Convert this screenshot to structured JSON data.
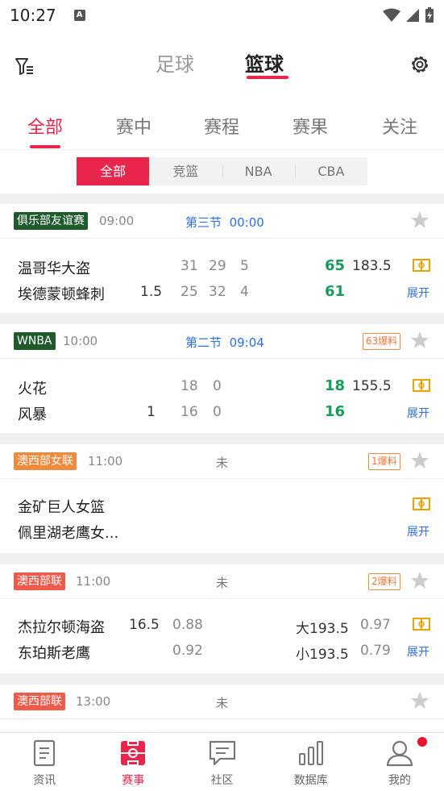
{
  "status": {
    "time": "10:27",
    "notif": "A"
  },
  "nav": {
    "football": "足球",
    "basketball": "篮球"
  },
  "categories": [
    "全部",
    "赛中",
    "赛程",
    "赛果",
    "关注"
  ],
  "segments": [
    "全部",
    "竞篮",
    "NBA",
    "CBA"
  ],
  "colors": {
    "accent": "#e8264c",
    "green": "#1a9a5c",
    "blue": "#2f6fe0",
    "league_dark": "#1e5a2a",
    "league_orange": "#f08a3c",
    "league_red": "#f05a4a"
  },
  "matches": [
    {
      "league": "俱乐部友谊赛",
      "time": "09:00",
      "period": "第三节",
      "clock": "00:00",
      "home": "温哥华大盗",
      "away": "埃德蒙顿蜂刺",
      "home_q": [
        "31",
        "29",
        "5"
      ],
      "away_q": [
        "25",
        "32",
        "4"
      ],
      "handicap": "1.5",
      "home_total": "65",
      "away_total": "61",
      "ou": "183.5",
      "expand": "展开"
    },
    {
      "league": "WNBA",
      "time": "10:00",
      "period": "第二节",
      "clock": "09:04",
      "tip": "63爆料",
      "home": "火花",
      "away": "风暴",
      "home_q": [
        "18",
        "0"
      ],
      "away_q": [
        "16",
        "0"
      ],
      "handicap": "1",
      "home_total": "18",
      "away_total": "16",
      "ou": "155.5",
      "expand": "展开"
    },
    {
      "league": "澳西部女联",
      "time": "11:00",
      "status": "未",
      "tip": "1爆料",
      "home": "金矿巨人女篮",
      "away": "佩里湖老鹰女...",
      "expand": "展开"
    },
    {
      "league": "澳西部联",
      "time": "11:00",
      "status": "未",
      "tip": "2爆料",
      "home": "杰拉尔顿海盗",
      "away": "东珀斯老鹰",
      "handicap": "16.5",
      "home_odds": "0.88",
      "away_odds": "0.92",
      "over": "大193.5",
      "over_odds": "0.97",
      "under": "小193.5",
      "under_odds": "0.79",
      "expand": "展开"
    },
    {
      "league": "澳西部联",
      "time": "13:00",
      "status": "未"
    }
  ],
  "tabbar": [
    "资讯",
    "赛事",
    "社区",
    "数据库",
    "我的"
  ]
}
